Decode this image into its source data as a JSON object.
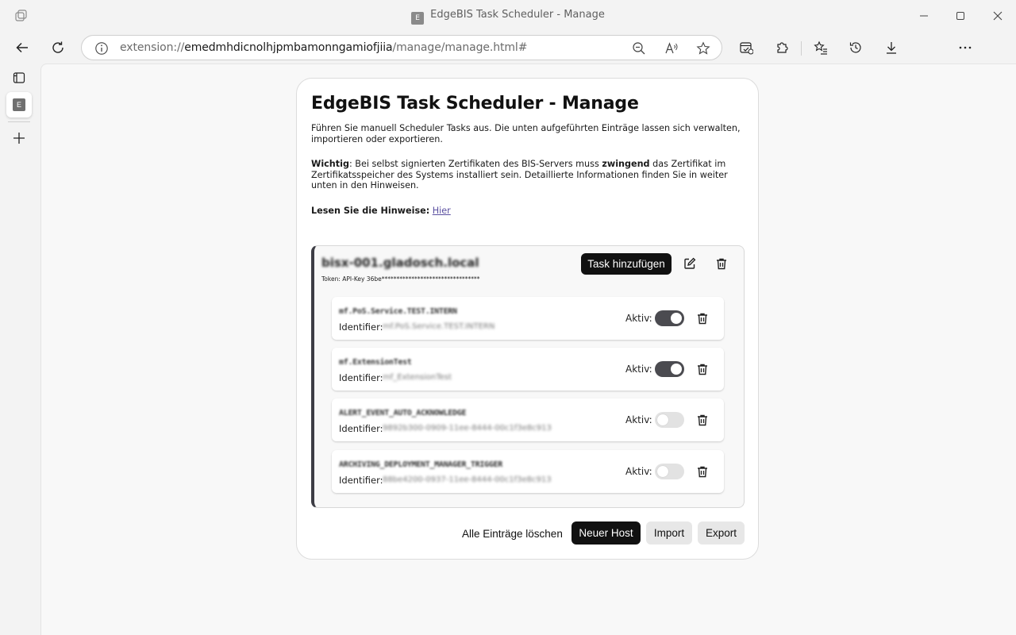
{
  "window": {
    "title": "EdgeBIS Task Scheduler - Manage",
    "favicon_letter": "E"
  },
  "address_bar": {
    "scheme": "extension://",
    "host": "emedmhdicnolhjpmbamonngamiofjiia",
    "path": "/manage/manage.html#"
  },
  "page": {
    "title": "EdgeBIS Task Scheduler - Manage",
    "intro": "Führen Sie manuell Scheduler Tasks aus. Die unten aufgeführten Einträge lassen sich verwalten, importieren oder exportieren.",
    "warning_label": "Wichtig",
    "warning_part1": ": Bei selbst signierten Zertifikaten des BIS-Servers muss ",
    "warning_emphasis": "zwingend",
    "warning_part2": " das Zertifikat im Zertifikatsspeicher des Systems installiert sein. Detaillierte Informationen finden Sie in weiter unten in den Hinweisen.",
    "hints_label": "Lesen Sie die Hinweise:",
    "hints_link": "Hier"
  },
  "host": {
    "name": "bisx-001.gladosch.local",
    "token": "Token: API-Key 36be*********************************",
    "add_task_label": "Task hinzufügen",
    "tasks": [
      {
        "name": "mf.PoS.Service.TEST.INTERN",
        "id_label": "Identifier:",
        "id": "mf.PoS.Service.TEST.INTERN",
        "active_label": "Aktiv:",
        "active": true
      },
      {
        "name": "mf.ExtensionTest",
        "id_label": "Identifier:",
        "id": "mf_ExtensionTest",
        "active_label": "Aktiv:",
        "active": true
      },
      {
        "name": "ALERT_EVENT_AUTO_ACKNOWLEDGE",
        "id_label": "Identifier:",
        "id": "9892b300-0909-11ee-8444-00c1f3e8c913",
        "active_label": "Aktiv:",
        "active": false
      },
      {
        "name": "ARCHIVING_DEPLOYMENT_MANAGER_TRIGGER",
        "id_label": "Identifier:",
        "id": "88be4200-0937-11ee-8444-00c1f3e8c913",
        "active_label": "Aktiv:",
        "active": false
      }
    ]
  },
  "footer": {
    "clear_all": "Alle Einträge löschen",
    "new_host": "Neuer Host",
    "import": "Import",
    "export": "Export"
  },
  "colors": {
    "accent_dark": "#111111",
    "toggle_on": "#4b4b50",
    "toggle_off": "#e2e2e2",
    "host_border": "#3d3d45"
  }
}
